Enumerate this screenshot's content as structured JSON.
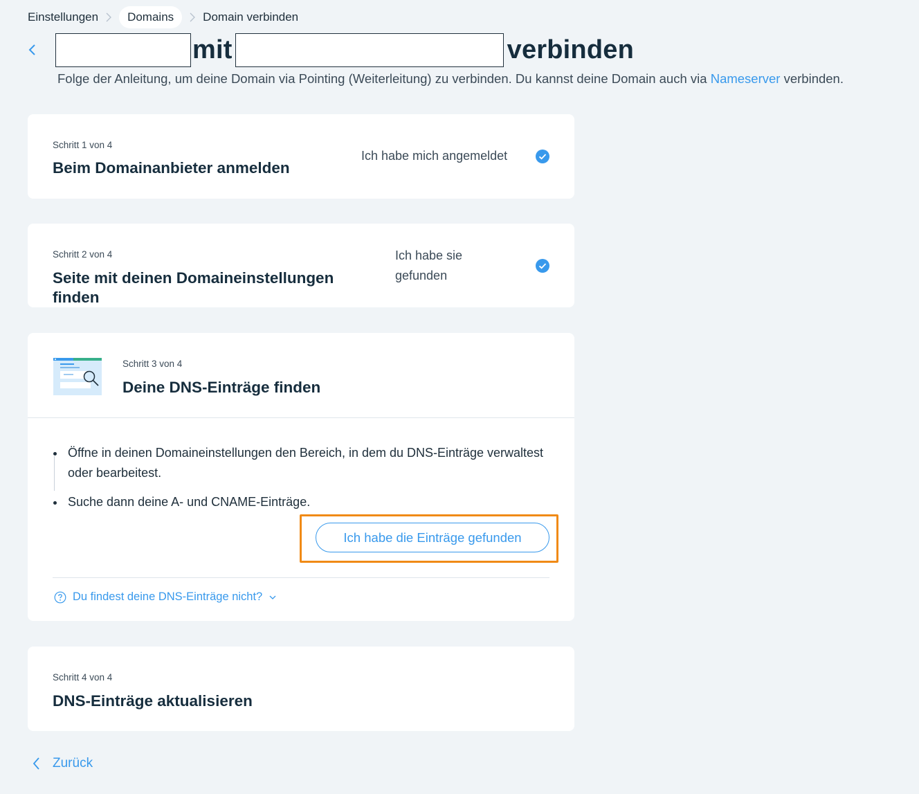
{
  "breadcrumb": {
    "items": [
      "Einstellungen",
      "Domains",
      "Domain verbinden"
    ]
  },
  "header": {
    "title_mid": "mit",
    "title_end": "verbinden",
    "subtitle_prefix": "Folge der Anleitung, um deine Domain via Pointing (Weiterleitung) zu verbinden. Du kannst deine Domain auch via ",
    "subtitle_link": "Nameserver",
    "subtitle_suffix": " verbinden."
  },
  "steps": [
    {
      "label": "Schritt 1 von 4",
      "title": "Beim Domainanbieter anmelden",
      "status": "Ich habe mich angemeldet",
      "checked": true
    },
    {
      "label": "Schritt 2 von 4",
      "title": "Seite mit deinen Domaineinstellungen finden",
      "status": "Ich habe sie gefunden",
      "checked": true
    },
    {
      "label": "Schritt 3 von 4",
      "title": "Deine DNS-Einträge finden",
      "bullets": [
        "Öffne in deinen Domaineinstellungen den Bereich, in dem du DNS-Einträge verwaltest oder bearbeitest.",
        "Suche dann deine A- und CNAME-Einträge."
      ],
      "button": "Ich habe die Einträge gefunden",
      "help": "Du findest deine DNS-Einträge nicht?"
    },
    {
      "label": "Schritt 4 von 4",
      "title": "DNS-Einträge aktualisieren"
    }
  ],
  "footer": {
    "back": "Zurück"
  },
  "colors": {
    "accent": "#3899ec",
    "check": "#3899ec",
    "highlight": "#f08a16",
    "background": "#f0f4f7"
  }
}
